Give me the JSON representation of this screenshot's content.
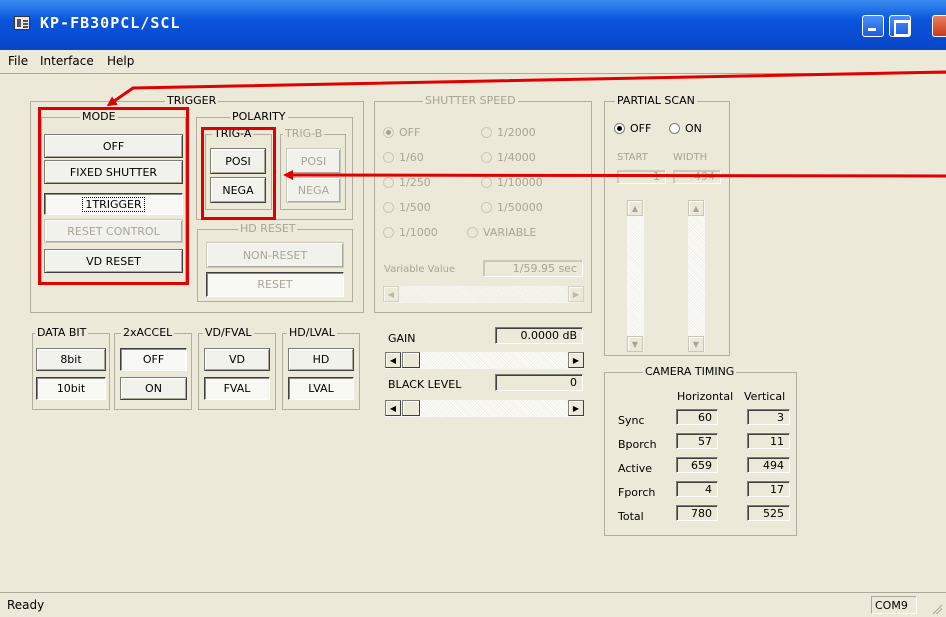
{
  "window": {
    "title": "KP-FB30PCL/SCL"
  },
  "menu": [
    "File",
    "Interface",
    "Help"
  ],
  "trigger": {
    "legend": "TRIGGER",
    "mode": {
      "legend": "MODE",
      "buttons": [
        "OFF",
        "FIXED SHUTTER",
        "1TRIGGER",
        "RESET CONTROL",
        "VD RESET"
      ]
    },
    "polarity": {
      "legend": "POLARITY",
      "trig_a": {
        "legend": "TRIG-A",
        "posi": "POSI",
        "nega": "NEGA"
      },
      "trig_b": {
        "legend": "TRIG-B",
        "posi": "POSI",
        "nega": "NEGA"
      }
    },
    "hd_reset": {
      "legend": "HD RESET",
      "non_reset": "NON-RESET",
      "reset": "RESET"
    }
  },
  "shutter": {
    "legend": "SHUTTER SPEED",
    "options": [
      "OFF",
      "1/2000",
      "1/60",
      "1/4000",
      "1/250",
      "1/10000",
      "1/500",
      "1/50000",
      "1/1000",
      "VARIABLE"
    ],
    "selected": "OFF",
    "variable_label": "Variable Value",
    "variable_value": "1/59.95 sec"
  },
  "partial": {
    "legend": "PARTIAL SCAN",
    "off": "OFF",
    "on": "ON",
    "selected": "OFF",
    "start_label": "START",
    "width_label": "WIDTH",
    "start_value": "1",
    "width_value": "494"
  },
  "data_bit": {
    "legend": "DATA BIT",
    "b1": "8bit",
    "b2": "10bit"
  },
  "accel": {
    "legend": "2xACCEL",
    "b1": "OFF",
    "b2": "ON"
  },
  "vdfval": {
    "legend": "VD/FVAL",
    "b1": "VD",
    "b2": "FVAL"
  },
  "hdlval": {
    "legend": "HD/LVAL",
    "b1": "HD",
    "b2": "LVAL"
  },
  "gain": {
    "label": "GAIN",
    "value": "0.0000 dB"
  },
  "black": {
    "label": "BLACK LEVEL",
    "value": "0"
  },
  "timing": {
    "legend": "CAMERA TIMING",
    "col_h": "Horizontal",
    "col_v": "Vertical",
    "rows": [
      {
        "label": "Sync",
        "h": "60",
        "v": "3"
      },
      {
        "label": "Bporch",
        "h": "57",
        "v": "11"
      },
      {
        "label": "Active",
        "h": "659",
        "v": "494"
      },
      {
        "label": "Fporch",
        "h": "4",
        "v": "17"
      },
      {
        "label": "Total",
        "h": "780",
        "v": "525"
      }
    ]
  },
  "status": {
    "text": "Ready",
    "port": "COM9"
  },
  "colors": {
    "annotation": "#e00000",
    "titlebar": "#0a54dd"
  }
}
